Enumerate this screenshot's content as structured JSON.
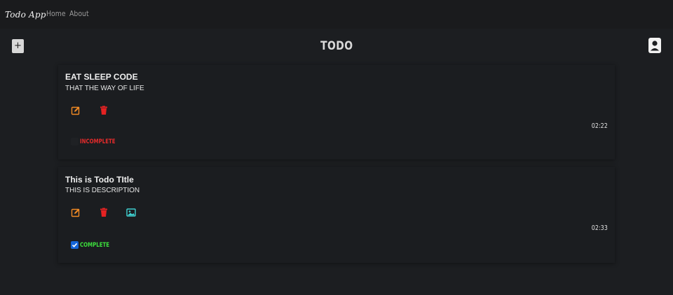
{
  "navbar": {
    "brand": "Todo App",
    "links": [
      {
        "label": "Home"
      },
      {
        "label": "About"
      }
    ]
  },
  "toolbar": {
    "add_label": "+",
    "title": "TODO",
    "profile_icon": "user-profile-icon"
  },
  "todos": [
    {
      "title": "EAT SLEEP CODE",
      "description": "THAT THE WAY OF LIFE",
      "time": "02:22",
      "status": "INCOMPLETE",
      "completed": false,
      "actions": [
        "edit-icon",
        "delete-icon"
      ]
    },
    {
      "title": "This is Todo TItle",
      "description": "THIS IS DESCRIPTION",
      "time": "02:33",
      "status": "COMPLETE",
      "completed": true,
      "actions": [
        "edit-icon",
        "delete-icon",
        "image-icon"
      ]
    }
  ],
  "colors": {
    "background": "#1c1e21",
    "card": "#1b1d20",
    "edit": "#f08a24",
    "delete": "#e52222",
    "image": "#3fd0d0",
    "incomplete": "#e52b2b",
    "complete": "#3de03d",
    "checkbox": "#1565d8"
  }
}
